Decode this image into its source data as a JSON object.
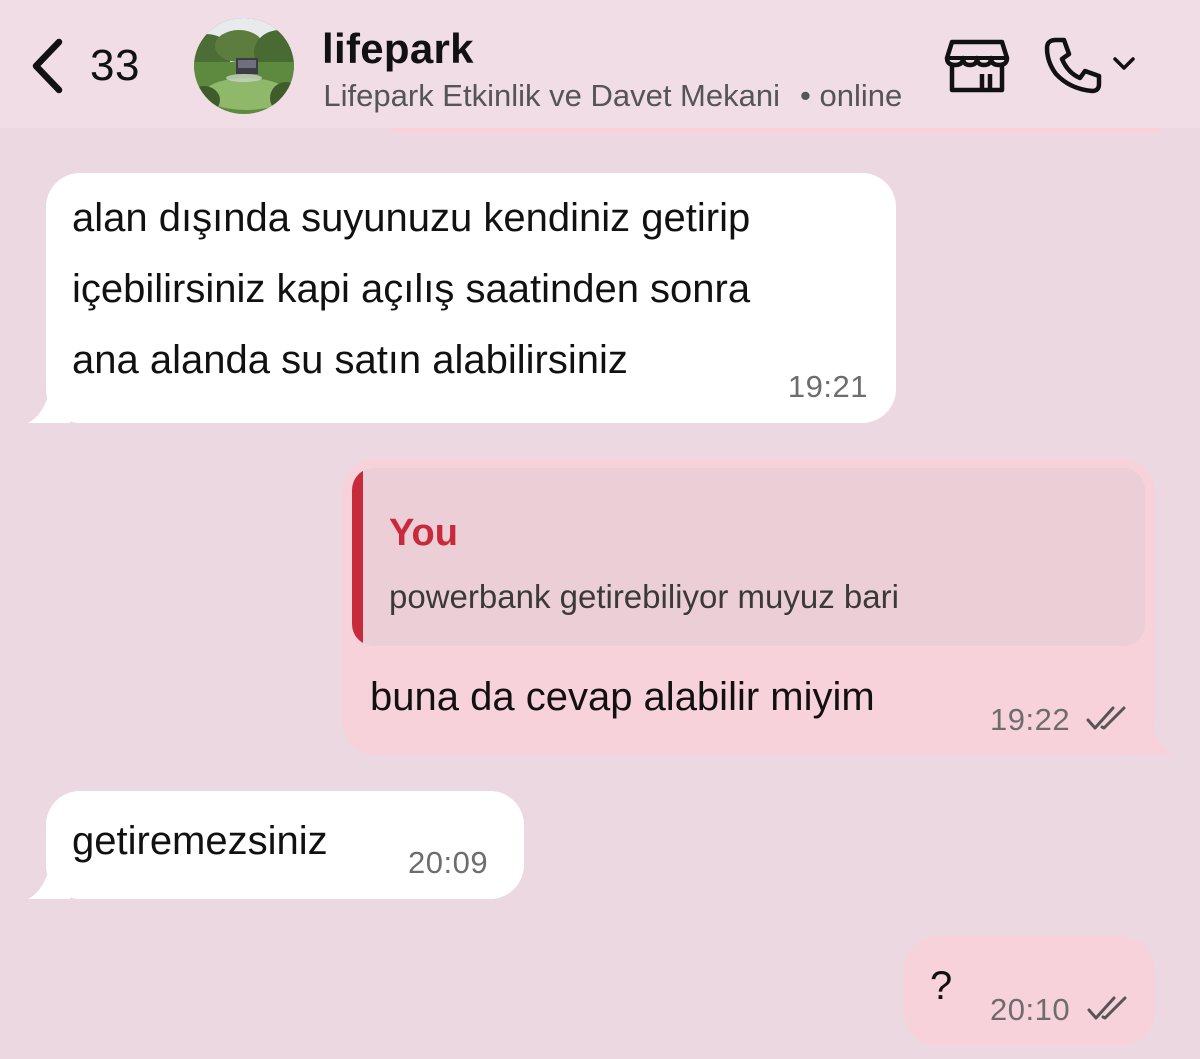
{
  "header": {
    "back_count": "33",
    "contact_name": "lifepark",
    "subtitle": "Lifepark Etkinlik ve Davet Mekani",
    "status": "• online",
    "icons": {
      "back": "chevron-left-icon",
      "store": "storefront-icon",
      "call": "phone-icon",
      "call_menu": "chevron-down-icon"
    }
  },
  "messages": [
    {
      "direction": "incoming",
      "lines": [
        "alan dışında suyunuzu kendiniz getirip",
        "içebilirsiniz kapi açılış saatinden sonra",
        "ana alanda su satın alabilirsiniz"
      ],
      "time": "19:21"
    },
    {
      "direction": "outgoing",
      "quote": {
        "author": "You",
        "text": "powerbank getirebiliyor muyuz bari"
      },
      "text": "buna da cevap alabilir miyim",
      "time": "19:22",
      "status": "read"
    },
    {
      "direction": "incoming",
      "text": "getiremezsiniz",
      "time": "20:09"
    },
    {
      "direction": "outgoing",
      "text": "?",
      "time": "20:10",
      "status": "read"
    }
  ],
  "colors": {
    "chat_background": "#ecd8e1",
    "header_background": "#f1dde5",
    "incoming_bubble": "#ffffff",
    "outgoing_bubble": "#f8d2db",
    "quote_accent": "#c62a3b"
  }
}
